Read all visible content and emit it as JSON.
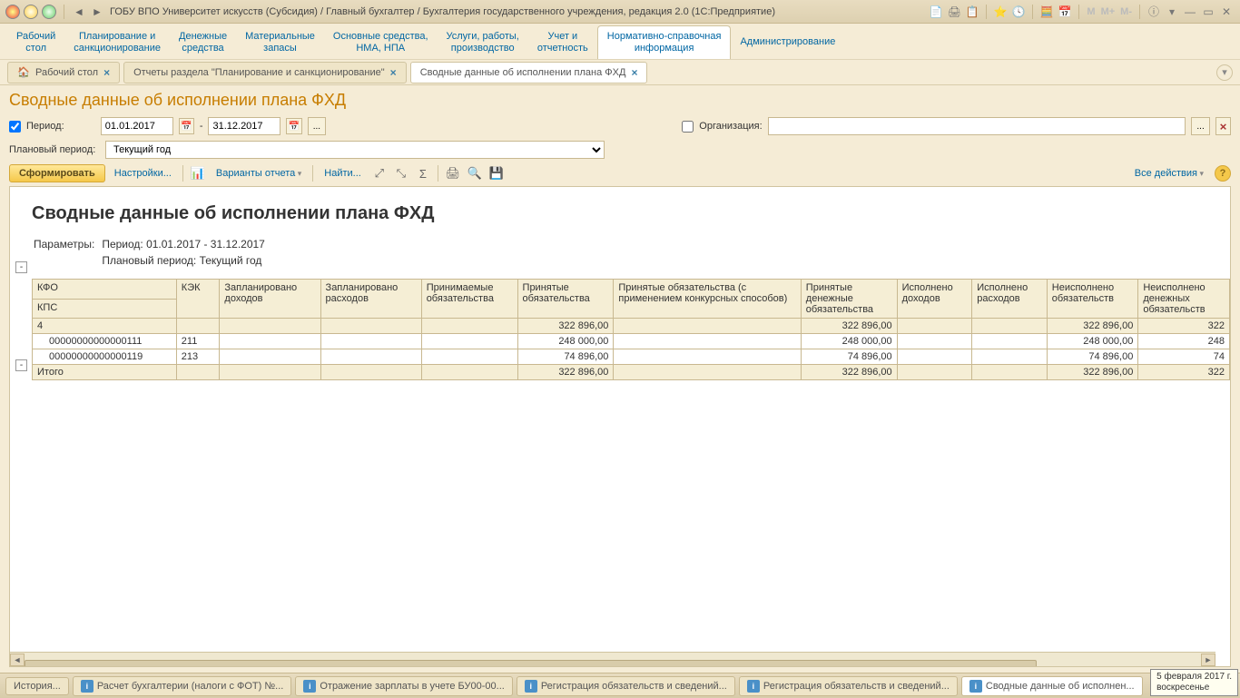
{
  "titlebar": {
    "title": "ГОБУ ВПО Университет искусств (Субсидия) / Главный бухгалтер / Бухгалтерия государственного учреждения, редакция 2.0  (1С:Предприятие)"
  },
  "nav": {
    "items": [
      "Рабочий\nстол",
      "Планирование и\nсанкционирование",
      "Денежные\nсредства",
      "Материальные\nзапасы",
      "Основные средства,\nНМА, НПА",
      "Услуги, работы,\nпроизводство",
      "Учет и\nотчетность",
      "Нормативно-справочная\nинформация",
      "Администрирование"
    ]
  },
  "tabs": {
    "t0": "Рабочий стол",
    "t1": "Отчеты раздела \"Планирование и санкционирование\"",
    "t2": "Сводные данные об исполнении плана ФХД"
  },
  "page": {
    "title": "Сводные данные об исполнении плана ФХД",
    "period_label": "Период:",
    "date_from": "01.01.2017",
    "date_sep": "-",
    "date_to": "31.12.2017",
    "org_label": "Организация:",
    "plan_label": "Плановый период:",
    "plan_value": "Текущий год"
  },
  "toolbar": {
    "form": "Сформировать",
    "settings": "Настройки...",
    "variants": "Варианты отчета",
    "find": "Найти...",
    "all_actions": "Все действия"
  },
  "report": {
    "title": "Сводные данные об исполнении плана ФХД",
    "params_label": "Параметры:",
    "param_period": "Период: 01.01.2017 - 31.12.2017",
    "param_plan": "Плановый период: Текущий год",
    "headers": {
      "kfo": "КФО",
      "kps": "КПС",
      "kek": "КЭК",
      "plan_income": "Запланировано доходов",
      "plan_expense": "Запланировано расходов",
      "accept_obl": "Принимаемые обязательства",
      "accepted_obl": "Принятые обязательства",
      "accepted_konk": "Принятые обязательства (с применением конкурсных способов)",
      "accepted_money": "Принятые денежные обязательства",
      "exec_income": "Исполнено доходов",
      "exec_expense": "Исполнено расходов",
      "unexec_obl": "Неисполнено обязательств",
      "unexec_money": "Неисполнено денежных обязательств"
    }
  },
  "chart_data": {
    "type": "table",
    "columns": [
      "КФО/КПС",
      "КЭК",
      "Запланировано доходов",
      "Запланировано расходов",
      "Принимаемые обязательства",
      "Принятые обязательства",
      "Принятые обязательства (с применением конкурсных способов)",
      "Принятые денежные обязательства",
      "Исполнено доходов",
      "Исполнено расходов",
      "Неисполнено обязательств",
      "Неисполнено денежных обязательств"
    ],
    "rows": [
      {
        "label": "4",
        "kek": "",
        "v": [
          "",
          "",
          "",
          "322 896,00",
          "",
          "322 896,00",
          "",
          "",
          "322 896,00",
          "322"
        ]
      },
      {
        "label": "00000000000000111",
        "kek": "211",
        "v": [
          "",
          "",
          "",
          "248 000,00",
          "",
          "248 000,00",
          "",
          "",
          "248 000,00",
          "248"
        ]
      },
      {
        "label": "00000000000000119",
        "kek": "213",
        "v": [
          "",
          "",
          "",
          "74 896,00",
          "",
          "74 896,00",
          "",
          "",
          "74 896,00",
          "74"
        ]
      },
      {
        "label": "Итого",
        "kek": "",
        "v": [
          "",
          "",
          "",
          "322 896,00",
          "",
          "322 896,00",
          "",
          "",
          "322 896,00",
          "322"
        ]
      }
    ]
  },
  "taskbar": {
    "history": "История...",
    "t1": "Расчет бухгалтерии (налоги с ФОТ) №...",
    "t2": "Отражение зарплаты в учете БУ00-00...",
    "t3": "Регистрация обязательств и сведений...",
    "t4": "Регистрация обязательств и сведений...",
    "t5": "Сводные данные об исполнен..."
  },
  "clock": {
    "date": "5 февраля 2017 г.",
    "day": "воскресенье"
  }
}
